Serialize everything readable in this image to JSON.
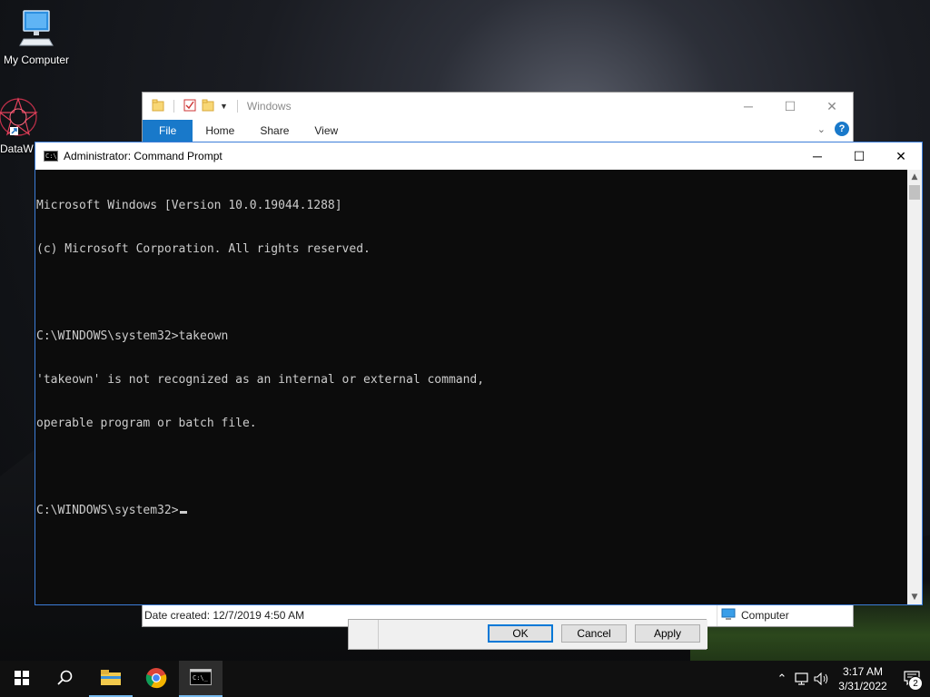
{
  "desktop": {
    "icons": [
      {
        "label": "My Computer",
        "icon": "computer-icon"
      },
      {
        "label": "DataW",
        "icon": "datawiper-icon"
      }
    ]
  },
  "explorer": {
    "title": "Windows",
    "tabs": [
      "File",
      "Home",
      "Share",
      "View"
    ],
    "status_left": "Date created: 12/7/2019 4:50 AM",
    "status_right": "Computer",
    "help_glyph": "?"
  },
  "properties_dialog": {
    "buttons": [
      "OK",
      "Cancel",
      "Apply"
    ]
  },
  "cmd": {
    "title": "Administrator: Command Prompt",
    "icon_text": "C:\\_",
    "lines": [
      "Microsoft Windows [Version 10.0.19044.1288]",
      "(c) Microsoft Corporation. All rights reserved.",
      "",
      "C:\\WINDOWS\\system32>takeown",
      "'takeown' is not recognized as an internal or external command,",
      "operable program or batch file.",
      "",
      "C:\\WINDOWS\\system32>"
    ]
  },
  "taskbar": {
    "apps": [
      "start-icon",
      "search-icon",
      "file-explorer-icon",
      "chrome-icon",
      "command-prompt-icon"
    ],
    "time": "3:17 AM",
    "date": "3/31/2022",
    "notification_count": "2"
  },
  "colors": {
    "accent": "#1979ca",
    "console_bg": "#0c0c0c",
    "console_fg": "#cccccc",
    "taskbar": "#101010"
  }
}
